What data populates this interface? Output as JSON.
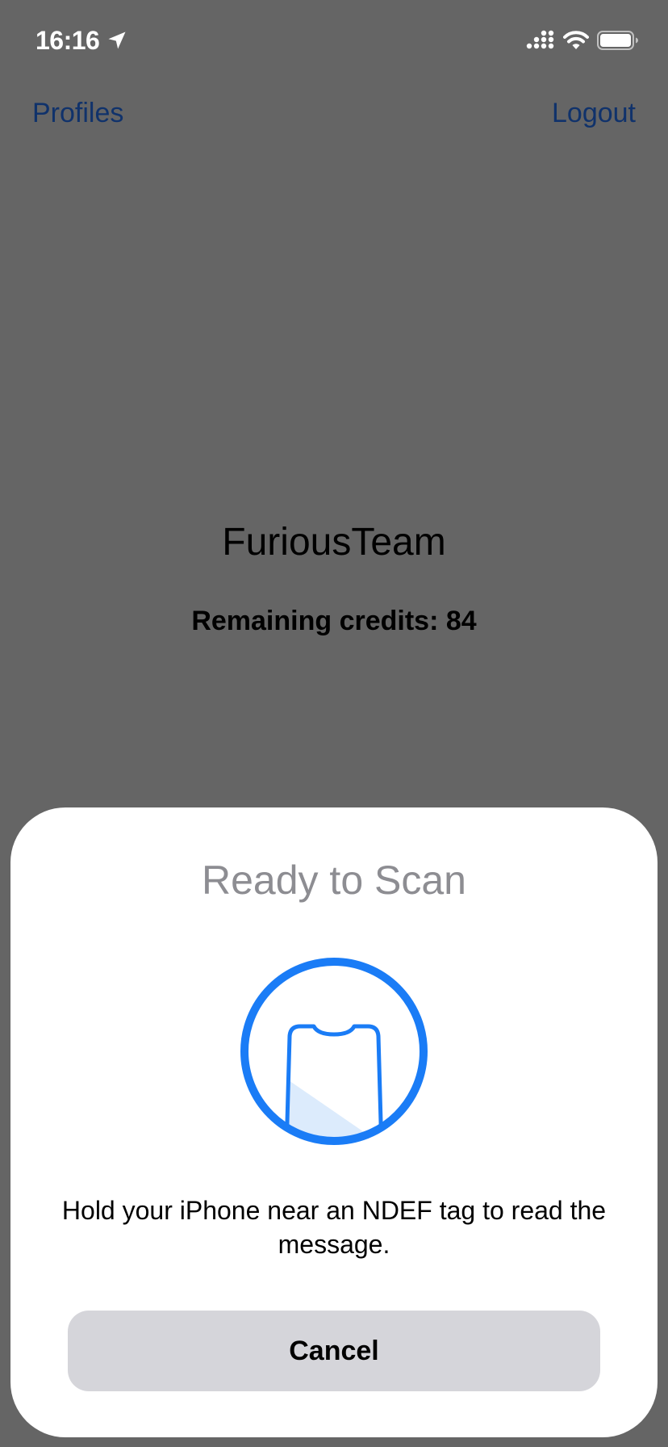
{
  "status_bar": {
    "time": "16:16",
    "icons": [
      "location-arrow-icon",
      "cellular-signal-icon",
      "wifi-icon",
      "battery-icon"
    ]
  },
  "nav": {
    "left_label": "Profiles",
    "right_label": "Logout",
    "link_color": "#10326b"
  },
  "main": {
    "team_name": "FuriousTeam",
    "credits_text": "Remaining credits: 84"
  },
  "scan_sheet": {
    "title": "Ready to Scan",
    "graphic_icon": "phone-scan-icon",
    "accent_color": "#1a7cf6",
    "message": "Hold your iPhone near an NDEF tag to read the message.",
    "cancel_label": "Cancel"
  }
}
